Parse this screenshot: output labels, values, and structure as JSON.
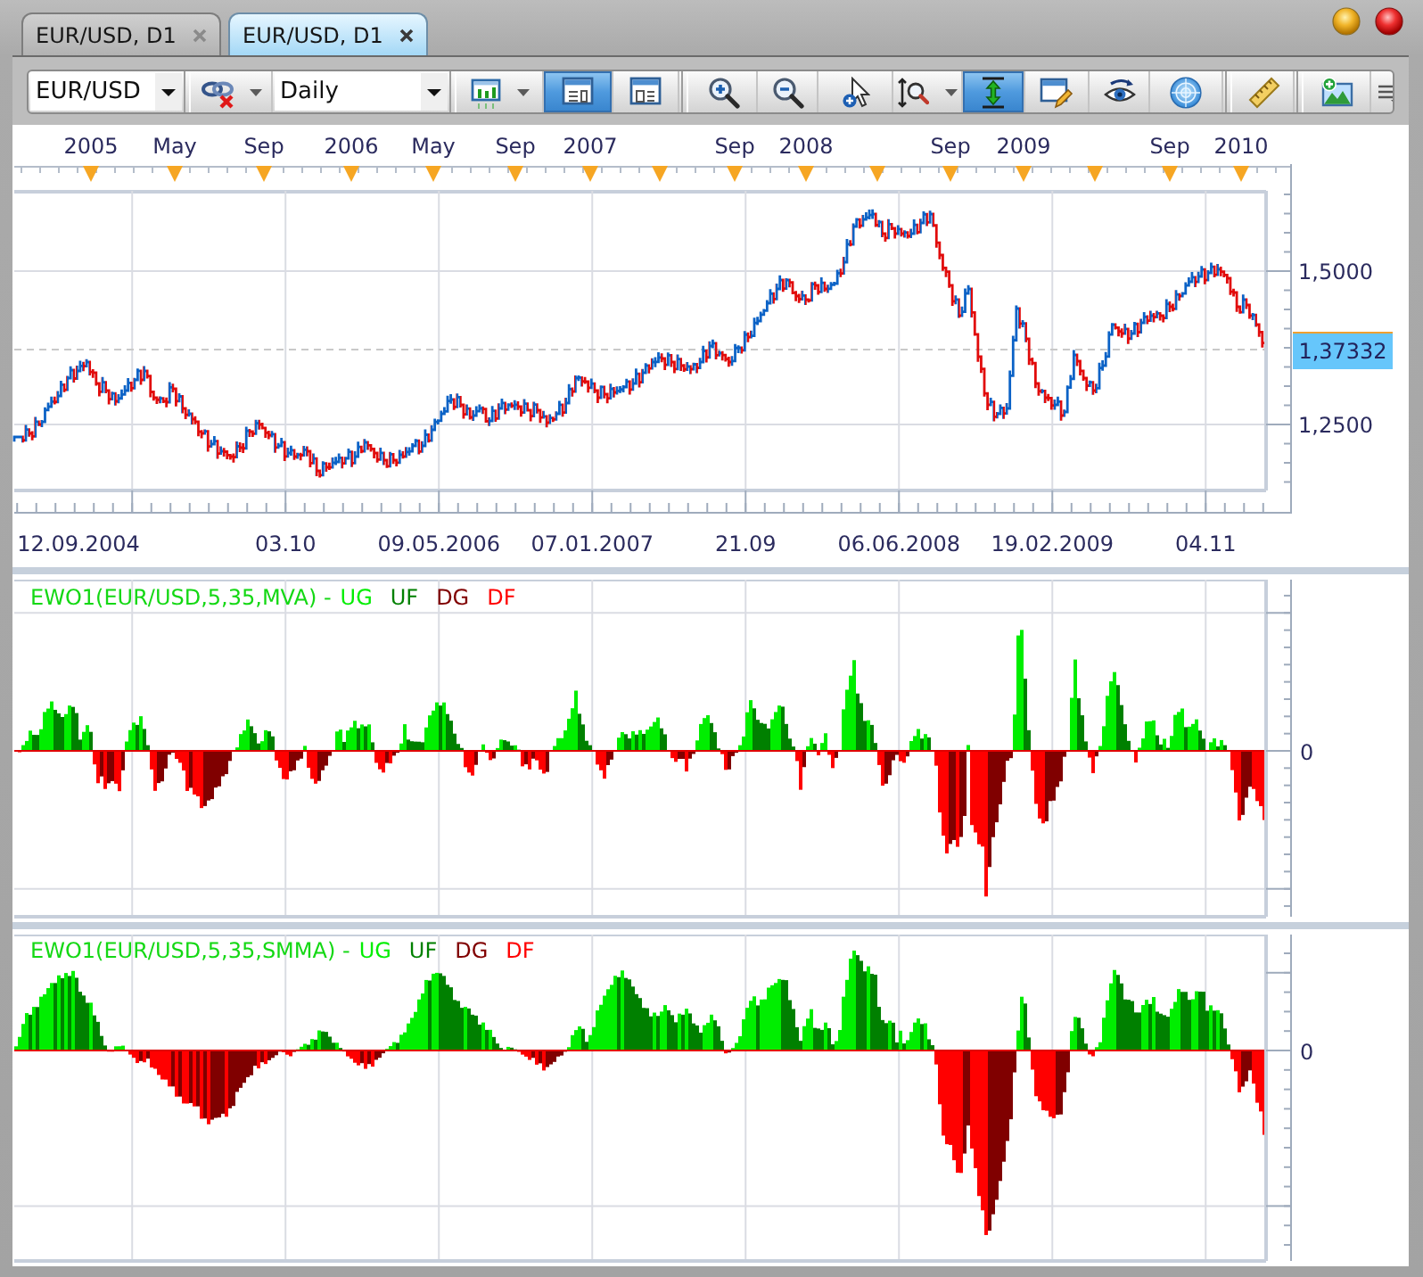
{
  "tabs": [
    {
      "label": "EUR/USD, D1",
      "selected": false
    },
    {
      "label": "EUR/USD, D1",
      "selected": true
    }
  ],
  "toolbar": {
    "items": [
      {
        "kind": "combo",
        "value": "EUR/USD"
      },
      {
        "kind": "separator"
      },
      {
        "kind": "dropdown-button",
        "selected": false
      },
      {
        "kind": "combo",
        "value": "Daily"
      },
      {
        "kind": "separator"
      },
      {
        "kind": "dropdown-button",
        "selected": false
      },
      {
        "kind": "button",
        "selected": true
      },
      {
        "kind": "button",
        "selected": false
      },
      {
        "kind": "separator"
      },
      {
        "kind": "button",
        "selected": false
      },
      {
        "kind": "button",
        "selected": false
      },
      {
        "kind": "button",
        "selected": false
      },
      {
        "kind": "dropdown-button",
        "selected": false
      },
      {
        "kind": "button",
        "selected": true
      },
      {
        "kind": "button",
        "selected": false
      },
      {
        "kind": "button",
        "selected": false
      },
      {
        "kind": "button",
        "selected": false
      },
      {
        "kind": "separator"
      },
      {
        "kind": "button",
        "selected": false
      },
      {
        "kind": "separator"
      },
      {
        "kind": "button",
        "selected": false
      },
      {
        "kind": "overflow"
      }
    ]
  },
  "timeline": {
    "labels": [
      "2005",
      "May",
      "Sep",
      "2006",
      "May",
      "Sep",
      "2007",
      "Sep",
      "2008",
      "Sep",
      "2009",
      "Sep",
      "2010"
    ]
  },
  "price_chart": {
    "y_axis_labels": [
      "1,5000",
      "1,2500"
    ],
    "current_price": "1,37332",
    "x_axis_labels": [
      "12.09.2004",
      "03.10",
      "09.05.2006",
      "07.01.2007",
      "21.09",
      "06.06.2008",
      "19.02.2009",
      "04.11"
    ]
  },
  "indicators": [
    {
      "title": "EWO1(EUR/USD,5,35,MVA) -",
      "legend": [
        {
          "label": "UG",
          "color": "#00ee00"
        },
        {
          "label": "UF",
          "color": "#008000"
        },
        {
          "label": "DG",
          "color": "#800000"
        },
        {
          "label": "DF",
          "color": "#ff0000"
        }
      ],
      "zero_label": "0"
    },
    {
      "title": "EWO1(EUR/USD,5,35,SMMA) -",
      "legend": [
        {
          "label": "UG",
          "color": "#00ee00"
        },
        {
          "label": "UF",
          "color": "#008000"
        },
        {
          "label": "DG",
          "color": "#800000"
        },
        {
          "label": "DF",
          "color": "#ff0000"
        }
      ],
      "zero_label": "0"
    }
  ]
}
